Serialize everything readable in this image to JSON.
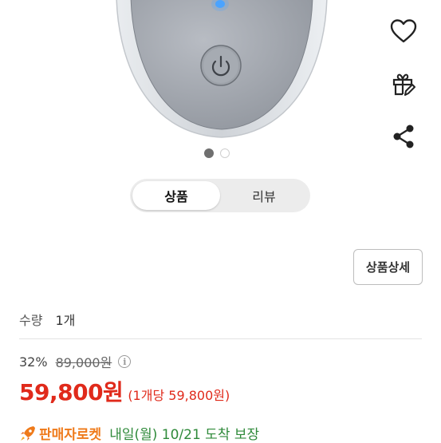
{
  "product_image": {
    "alt": "product photo"
  },
  "side_actions": [
    "heart-icon",
    "gift-icon",
    "share-icon"
  ],
  "gallery": {
    "current": 1,
    "total": 2
  },
  "tabs": [
    {
      "label": "상품",
      "active": true
    },
    {
      "label": "리뷰",
      "active": false
    }
  ],
  "detail_button": "상품상세",
  "quantity": {
    "label": "수량",
    "value": "1개"
  },
  "pricing": {
    "discount": "32%",
    "original_price": "89,000원",
    "info_icon_glyph": "i",
    "price": "59,800원",
    "unit_price": "(1개당 59,800원)"
  },
  "delivery": {
    "badge": "판매자로켓",
    "text": "내일(월) 10/21 도착 보장"
  },
  "colors": {
    "price": "#e02a1b",
    "rocket": "#ef7a1a",
    "delivery": "#2f8a3a"
  }
}
